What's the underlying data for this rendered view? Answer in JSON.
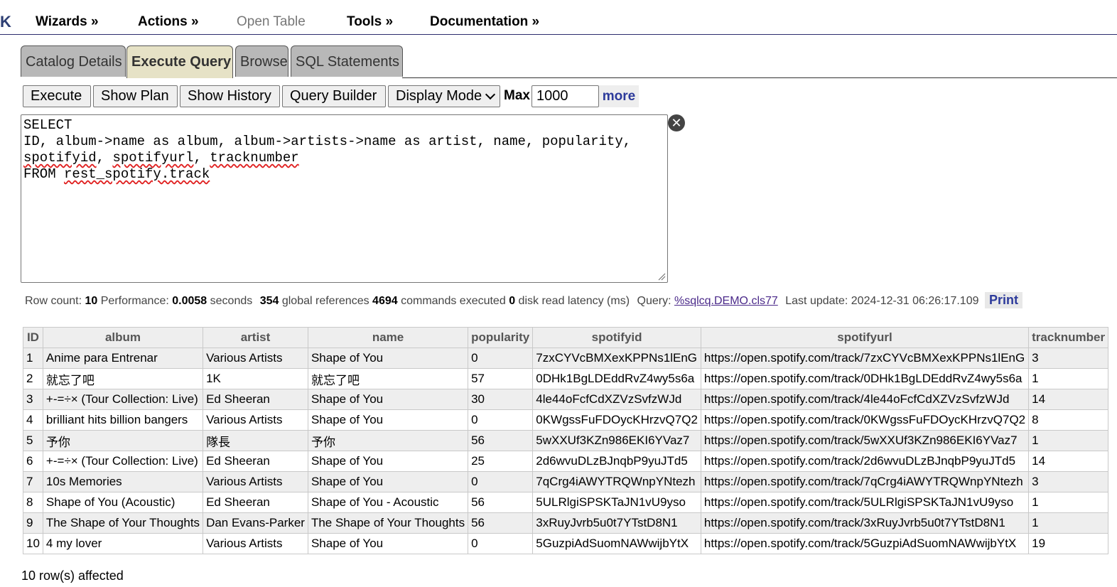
{
  "menu": {
    "logo": "K",
    "items": [
      {
        "label": "Wizards »"
      },
      {
        "label": "Actions »"
      },
      {
        "label": "Open Table"
      },
      {
        "label": "Tools »"
      },
      {
        "label": "Documentation »"
      }
    ]
  },
  "tabs": [
    {
      "label": "Catalog Details"
    },
    {
      "label": "Execute Query"
    },
    {
      "label": "Browse"
    },
    {
      "label": "SQL Statements"
    }
  ],
  "active_tab": "Execute Query",
  "toolbar": {
    "execute": "Execute",
    "show_plan": "Show Plan",
    "show_history": "Show History",
    "query_builder": "Query Builder",
    "display_mode": "Display Mode",
    "max_label": "Max",
    "max_value": "1000",
    "more": "more"
  },
  "query": {
    "l1": "SELECT",
    "l2": "ID, album->name as album, album->artists->name as artist, name, popularity,",
    "l3a": "spotifyid",
    "l3b": ", ",
    "l3c": "spotifyurl",
    "l3d": ", ",
    "l3e": "tracknumber",
    "l4a": "FROM ",
    "l4b": "rest_spotify.track"
  },
  "stats": {
    "row_count_label": "Row count:",
    "row_count": "10",
    "performance_label": "Performance:",
    "performance": "0.0058",
    "seconds_label": "seconds",
    "global_refs": "354",
    "global_refs_label": "global references",
    "commands": "4694",
    "commands_label": "commands executed",
    "disk": "0",
    "disk_label": "disk read latency (ms)",
    "query_label": "Query:",
    "query_link": "%sqlcq.DEMO.cls77",
    "last_update_label": "Last update:",
    "last_update": "2024-12-31 06:26:17.109",
    "print": "Print"
  },
  "results": {
    "columns": [
      "ID",
      "album",
      "artist",
      "name",
      "popularity",
      "spotifyid",
      "spotifyurl",
      "tracknumber"
    ],
    "rows": [
      [
        "1",
        "Anime para Entrenar",
        "Various Artists",
        "Shape of You",
        "0",
        "7zxCYVcBMXexKPPNs1lEnG",
        "https://open.spotify.com/track/7zxCYVcBMXexKPPNs1lEnG",
        "3"
      ],
      [
        "2",
        "就忘了吧",
        "1K",
        "就忘了吧",
        "57",
        "0DHk1BgLDEddRvZ4wy5s6a",
        "https://open.spotify.com/track/0DHk1BgLDEddRvZ4wy5s6a",
        "1"
      ],
      [
        "3",
        "+-=÷× (Tour Collection: Live)",
        "Ed Sheeran",
        "Shape of You",
        "30",
        "4le44oFcfCdXZVzSvfzWJd",
        "https://open.spotify.com/track/4le44oFcfCdXZVzSvfzWJd",
        "14"
      ],
      [
        "4",
        "brilliant hits billion bangers",
        "Various Artists",
        "Shape of You",
        "0",
        "0KWgssFuFDOycKHrzvQ7Q2",
        "https://open.spotify.com/track/0KWgssFuFDOycKHrzvQ7Q2",
        "8"
      ],
      [
        "5",
        "予你",
        "隊長",
        "予你",
        "56",
        "5wXXUf3KZn986EKI6YVaz7",
        "https://open.spotify.com/track/5wXXUf3KZn986EKI6YVaz7",
        "1"
      ],
      [
        "6",
        "+-=÷× (Tour Collection: Live)",
        "Ed Sheeran",
        "Shape of You",
        "25",
        "2d6wvuDLzBJnqbP9yuJTd5",
        "https://open.spotify.com/track/2d6wvuDLzBJnqbP9yuJTd5",
        "14"
      ],
      [
        "7",
        "10s Memories",
        "Various Artists",
        "Shape of You",
        "0",
        "7qCrg4iAWYTRQWnpYNtezh",
        "https://open.spotify.com/track/7qCrg4iAWYTRQWnpYNtezh",
        "3"
      ],
      [
        "8",
        "Shape of You (Acoustic)",
        "Ed Sheeran",
        "Shape of You - Acoustic",
        "56",
        "5ULRlgiSPSKTaJN1vU9yso",
        "https://open.spotify.com/track/5ULRlgiSPSKTaJN1vU9yso",
        "1"
      ],
      [
        "9",
        "The Shape of Your Thoughts",
        "Dan Evans-Parker",
        "The Shape of Your Thoughts",
        "56",
        "3xRuyJvrb5u0t7YTstD8N1",
        "https://open.spotify.com/track/3xRuyJvrb5u0t7YTstD8N1",
        "1"
      ],
      [
        "10",
        "4 my lover",
        "Various Artists",
        "Shape of You",
        "0",
        "5GuzpiAdSuomNAWwijbYtX",
        "https://open.spotify.com/track/5GuzpiAdSuomNAWwijbYtX",
        "19"
      ]
    ]
  },
  "affected": "10 row(s) affected",
  "icons": {
    "clear": "close-circle-icon",
    "resize": "resize-grip-icon"
  }
}
